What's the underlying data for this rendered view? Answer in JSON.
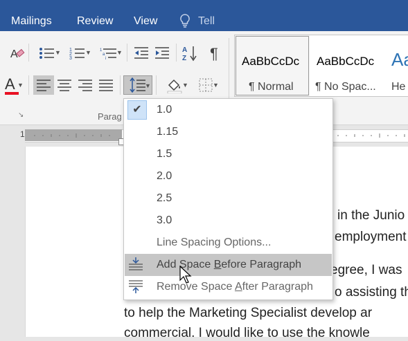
{
  "tabs": [
    "Mailings",
    "Review",
    "View"
  ],
  "tell_me": {
    "placeholder": "Tell me what you want to do..."
  },
  "ribbon": {
    "group_label": "Paragraph",
    "group_label_visible": "Parag",
    "styles": [
      {
        "sample": "AaBbCcDc",
        "name": "¶ Normal",
        "active": true
      },
      {
        "sample": "AaBbCcDc",
        "name": "¶ No Spac...",
        "active": false
      },
      {
        "sample": "Aa",
        "name": "He",
        "active": false
      }
    ],
    "colors": {
      "accent": "#2b579a",
      "font_color_underline": "#e81123"
    }
  },
  "ruler": {
    "number": "1"
  },
  "menu": {
    "items": [
      {
        "label": "1.0",
        "checked": true
      },
      {
        "label": "1.15",
        "checked": false
      },
      {
        "label": "1.5",
        "checked": false
      },
      {
        "label": "2.0",
        "checked": false
      },
      {
        "label": "2.5",
        "checked": false
      },
      {
        "label": "3.0",
        "checked": false
      }
    ],
    "options_label": "Line Spacing Options...",
    "add_before": {
      "pre": "Add Space ",
      "key": "B",
      "post": "efore Paragraph",
      "icon": "add-space-before-icon"
    },
    "remove_after": {
      "pre": "Remove Space ",
      "key": "A",
      "post": "fter Paragraph",
      "icon": "remove-space-after-icon"
    }
  },
  "document": {
    "lines": [
      " in the Junio",
      "employment",
      "egree, I was",
      "o assisting th",
      "to help the Marketing Specialist develop ar",
      "commercial. I would like to use the knowle"
    ]
  }
}
